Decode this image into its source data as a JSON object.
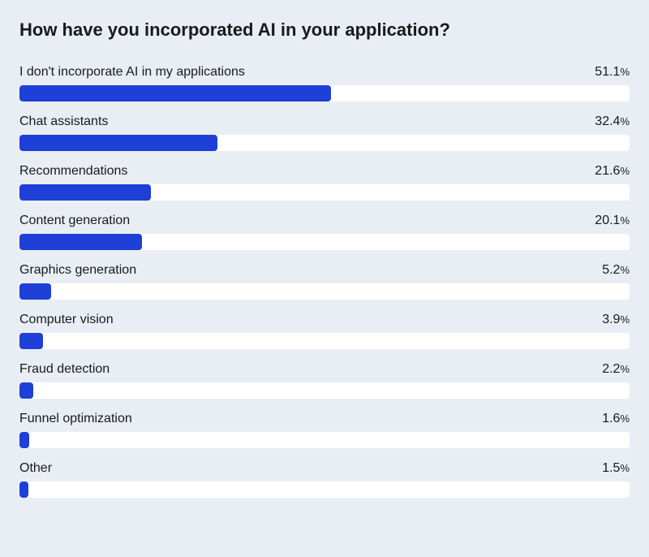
{
  "chart_data": {
    "type": "bar",
    "title": "How have you incorporated AI in your application?",
    "xlabel": "",
    "ylabel": "",
    "ylim": [
      0,
      100
    ],
    "categories": [
      "I don't incorporate AI in my applications",
      "Chat assistants",
      "Recommendations",
      "Content generation",
      "Graphics generation",
      "Computer vision",
      "Fraud detection",
      "Funnel optimization",
      "Other"
    ],
    "values": [
      51.1,
      32.4,
      21.6,
      20.1,
      5.2,
      3.9,
      2.2,
      1.6,
      1.5
    ],
    "value_suffix": "%",
    "bar_color": "#1e3fd8",
    "track_color": "#ffffff",
    "background": "#e9eef4"
  }
}
